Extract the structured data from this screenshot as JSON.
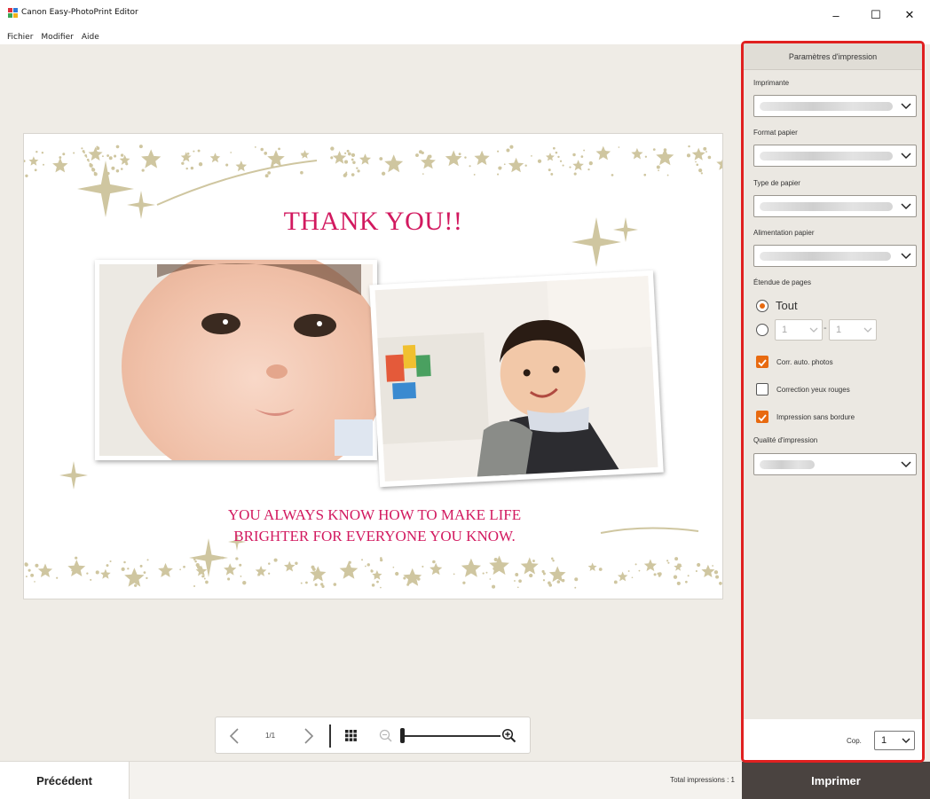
{
  "window": {
    "title": "Canon Easy-PhotoPrint Editor",
    "minimize": "–",
    "maximize": "☐",
    "close": "✕"
  },
  "menu": [
    "Fichier",
    "Modifier",
    "Aide"
  ],
  "card": {
    "title": "THANK YOU!!",
    "message_line1": "YOU ALWAYS KNOW HOW TO MAKE LIFE",
    "message_line2": "BRIGHTER FOR EVERYONE YOU KNOW.",
    "text_color": "#d2195f",
    "star_color": "#cfc6a0"
  },
  "pager": {
    "prev_icon": "chevron-left-icon",
    "next_icon": "chevron-right-icon",
    "page_indicator": "1/1",
    "grid_icon": "grid-icon",
    "zoom_out_icon": "zoom-out-icon",
    "zoom_in_icon": "zoom-in-icon",
    "zoom_level": 0
  },
  "settings": {
    "header": "Paramètres d'impression",
    "printer_label": "Imprimante",
    "paper_size_label": "Format papier",
    "paper_type_label": "Type de papier",
    "paper_source_label": "Alimentation papier",
    "page_range_label": "Étendue de pages",
    "range_all": "Tout",
    "range_from": "1",
    "range_to": "1",
    "range_dash": "-",
    "auto_photo_fix": "Corr. auto. photos",
    "auto_photo_fix_checked": true,
    "red_eye": "Correction yeux rouges",
    "red_eye_checked": false,
    "borderless": "Impression sans bordure",
    "borderless_checked": true,
    "quality_label": "Qualité d'impression",
    "copies_label": "Cop.",
    "copies_value": "1",
    "accent_color": "#e86a10",
    "highlight_color": "#e02020"
  },
  "footer": {
    "prev_button": "Précédent",
    "total": "Total impressions : 1",
    "print_button": "Imprimer"
  }
}
